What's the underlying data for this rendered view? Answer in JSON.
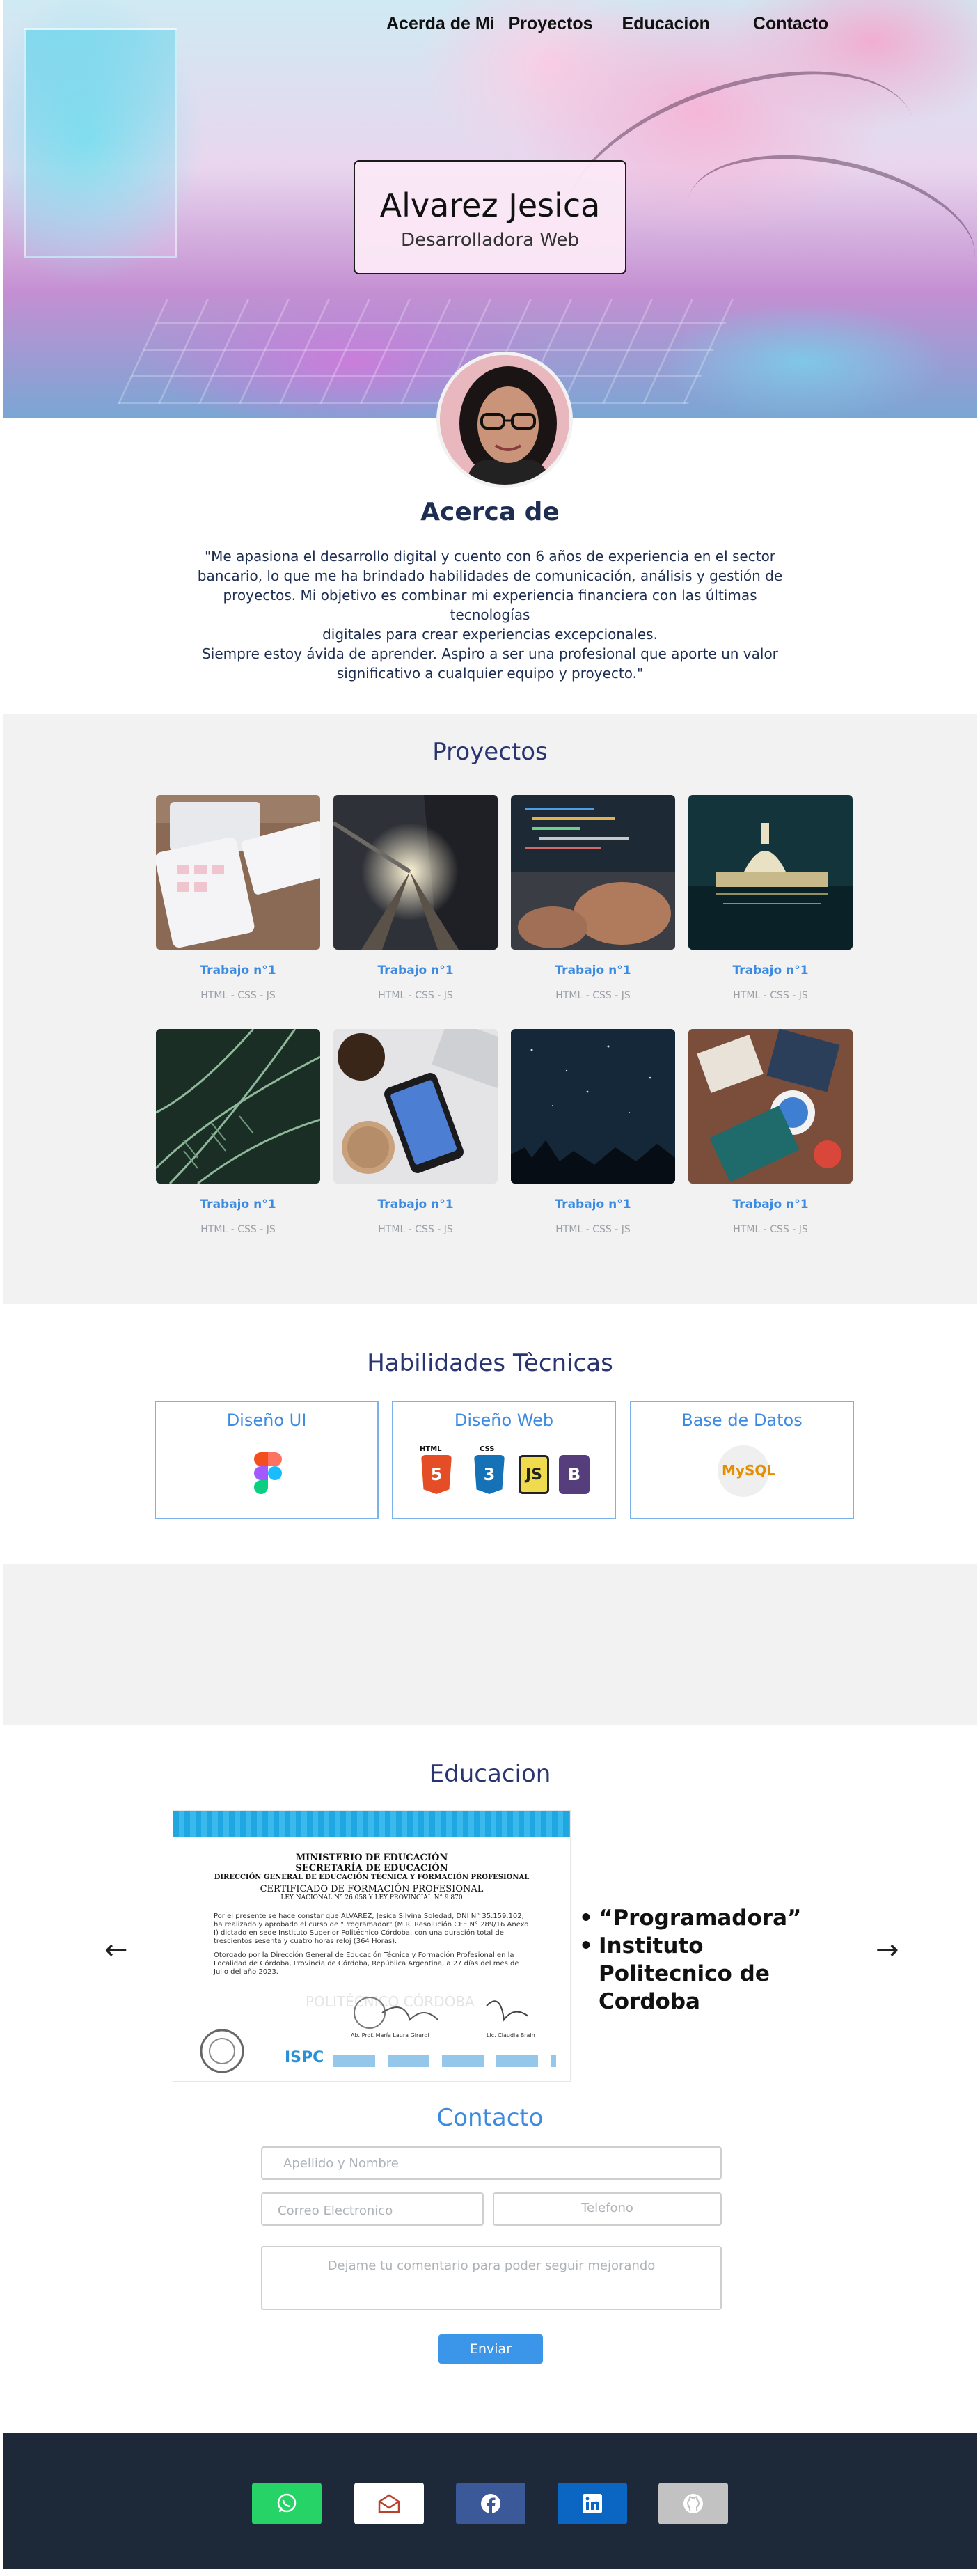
{
  "nav": {
    "items": [
      "Acerda de Mi",
      "Proyectos",
      "Educacion",
      "Contacto"
    ]
  },
  "hero": {
    "name": "Alvarez Jesica",
    "role": "Desarrolladora Web"
  },
  "about": {
    "title": "Acerca de",
    "lines": [
      "\"Me apasiona el desarrollo digital y cuento con 6 años de experiencia en el sector",
      "bancario, lo que me ha brindado habilidades de comunicación, análisis y gestión de",
      "proyectos. Mi objetivo es combinar mi experiencia financiera con las últimas tecnologías",
      "digitales para crear experiencias excepcionales.",
      "Siempre estoy ávida de aprender. Aspiro a ser una profesional que aporte un valor",
      "significativo a cualquier equipo y proyecto.\""
    ]
  },
  "projects": {
    "title": "Proyectos",
    "items": [
      {
        "title": "Trabajo n°1",
        "tags": "HTML - CSS - JS",
        "image": "keyboard-calculator-photo"
      },
      {
        "title": "Trabajo n°1",
        "tags": "HTML - CSS - JS",
        "image": "railway-sunset-photo"
      },
      {
        "title": "Trabajo n°1",
        "tags": "HTML - CSS - JS",
        "image": "laptop-code-photo"
      },
      {
        "title": "Trabajo n°1",
        "tags": "HTML - CSS - JS",
        "image": "night-city-photo"
      },
      {
        "title": "Trabajo n°1",
        "tags": "HTML - CSS - JS",
        "image": "fern-leaves-photo"
      },
      {
        "title": "Trabajo n°1",
        "tags": "HTML - CSS - JS",
        "image": "desk-phone-photo"
      },
      {
        "title": "Trabajo n°1",
        "tags": "HTML - CSS - JS",
        "image": "starry-sky-photo"
      },
      {
        "title": "Trabajo n°1",
        "tags": "HTML - CSS - JS",
        "image": "workspace-flatlay-photo"
      }
    ]
  },
  "skills": {
    "title": "Habilidades Tècnicas",
    "cards": [
      {
        "title": "Diseño UI",
        "icons": [
          "figma-icon"
        ]
      },
      {
        "title": "Diseño Web",
        "icons": [
          "html5-icon",
          "css3-icon",
          "javascript-icon",
          "bootstrap-icon"
        ],
        "labels": {
          "html": "HTML",
          "css": "CSS",
          "html_num": "5",
          "css_num": "3",
          "js": "JS",
          "bootstrap": "B"
        }
      },
      {
        "title": "Base de Datos",
        "icons": [
          "mysql-icon"
        ],
        "labels": {
          "mysql": "MySQL"
        }
      }
    ]
  },
  "education": {
    "title": "Educacion",
    "items": [
      "“Programadora”",
      "Instituto Politecnico de Cordoba"
    ],
    "prev_arrow": "←",
    "next_arrow": "→",
    "certificate": {
      "l1": "MINISTERIO DE EDUCACIÓN",
      "l2": "SECRETARÍA DE EDUCACIÓN",
      "l3": "DIRECCIÓN GENERAL DE EDUCACIÓN TÉCNICA Y FORMACIÓN PROFESIONAL",
      "l4": "CERTIFICADO DE FORMACIÓN PROFESIONAL",
      "l5": "LEY NACIONAL N° 26.058 Y LEY PROVINCIAL N° 9.870",
      "body": "Por el presente se hace constar que ALVAREZ, Jesica Silvina Soledad, DNI N° 35.159.102, ha realizado y aprobado el curso de \"Programador\" (M.R. Resolución CFE N° 289/16 Anexo I) dictado en sede Instituto Superior Politécnico Córdoba, con una duración total de trescientos sesenta y cuatro horas reloj (364 Horas).",
      "body2": "Otorgado por la Dirección General de Educación Técnica y Formación Profesional en la Localidad de Córdoba, Provincia de Córdoba, República Argentina, a 27 días del mes de Julio del año 2023.",
      "watermark": "POLITÉCNICO CÓRDOBA",
      "sig1": "Ab. Prof. María Laura Girardi",
      "sig2": "Lic. Claudia Brain",
      "logo": "ISPC"
    }
  },
  "contact": {
    "title": "Contacto",
    "name_placeholder": "Apellido y Nombre",
    "email_placeholder": "Correo Electronico",
    "phone_placeholder": "Telefono",
    "comment_placeholder": "Dejame tu comentario para poder seguir mejorando",
    "send_label": "Enviar"
  },
  "footer": {
    "social": [
      {
        "name": "whatsapp-icon",
        "bg": "#25d366"
      },
      {
        "name": "mail-icon",
        "bg": "#ffffff"
      },
      {
        "name": "facebook-icon",
        "bg": "#3b5998"
      },
      {
        "name": "linkedin-icon",
        "bg": "#0a66c2"
      },
      {
        "name": "github-icon",
        "bg": "#c2c2c2"
      }
    ]
  },
  "colors": {
    "accent": "#3d8be0",
    "heading": "#2a3470",
    "footer": "#1d2838",
    "section_gray": "#f2f2f2"
  }
}
